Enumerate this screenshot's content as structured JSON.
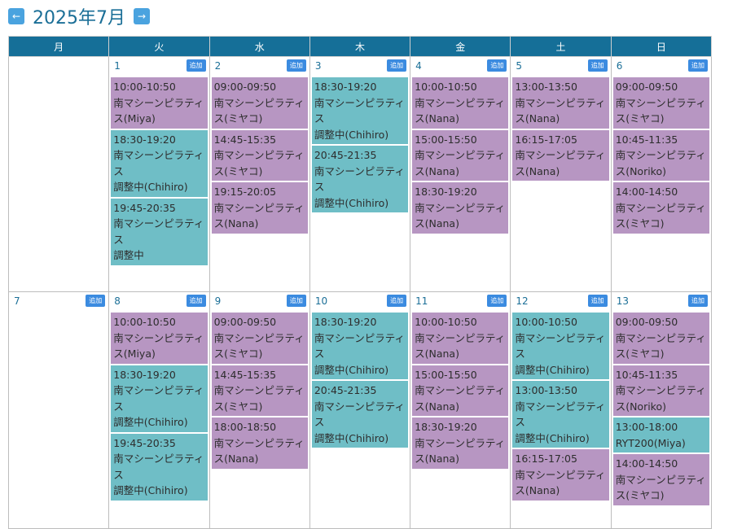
{
  "header": {
    "prev_label": "←",
    "title": "2025年7月",
    "next_label": "→"
  },
  "weekdays": [
    "月",
    "火",
    "水",
    "木",
    "金",
    "土",
    "日"
  ],
  "add_label": "追加",
  "colors": {
    "purple": "#b796c2",
    "teal": "#6fbec6",
    "header": "#156f98",
    "accent": "#1b6f97"
  },
  "weeks": [
    [
      {
        "date": "",
        "events": []
      },
      {
        "date": "1",
        "events": [
          {
            "time": "10:00-10:50",
            "title": "南マシーンピラティス(Miya)",
            "note": "",
            "color": "purple"
          },
          {
            "time": "18:30-19:20",
            "title": "南マシーンピラティス",
            "note": "調整中(Chihiro)",
            "color": "teal"
          },
          {
            "time": "19:45-20:35",
            "title": "南マシーンピラティス",
            "note": "調整中",
            "color": "teal"
          }
        ]
      },
      {
        "date": "2",
        "events": [
          {
            "time": "09:00-09:50",
            "title": "南マシーンピラティス(ミヤコ)",
            "note": "",
            "color": "purple"
          },
          {
            "time": "14:45-15:35",
            "title": "南マシーンピラティス(ミヤコ)",
            "note": "",
            "color": "purple"
          },
          {
            "time": "19:15-20:05",
            "title": "南マシーンピラティス(Nana)",
            "note": "",
            "color": "purple"
          }
        ]
      },
      {
        "date": "3",
        "events": [
          {
            "time": "18:30-19:20",
            "title": "南マシーンピラティス",
            "note": "調整中(Chihiro)",
            "color": "teal"
          },
          {
            "time": "20:45-21:35",
            "title": "南マシーンピラティス",
            "note": "調整中(Chihiro)",
            "color": "teal"
          }
        ]
      },
      {
        "date": "4",
        "events": [
          {
            "time": "10:00-10:50",
            "title": "南マシーンピラティス(Nana)",
            "note": "",
            "color": "purple"
          },
          {
            "time": "15:00-15:50",
            "title": "南マシーンピラティス(Nana)",
            "note": "",
            "color": "purple"
          },
          {
            "time": "18:30-19:20",
            "title": "南マシーンピラティス(Nana)",
            "note": "",
            "color": "purple"
          }
        ]
      },
      {
        "date": "5",
        "events": [
          {
            "time": "13:00-13:50",
            "title": "南マシーンピラティス(Nana)",
            "note": "",
            "color": "purple"
          },
          {
            "time": "16:15-17:05",
            "title": "南マシーンピラティス(Nana)",
            "note": "",
            "color": "purple"
          }
        ]
      },
      {
        "date": "6",
        "events": [
          {
            "time": "09:00-09:50",
            "title": "南マシーンピラティス(ミヤコ)",
            "note": "",
            "color": "purple"
          },
          {
            "time": "10:45-11:35",
            "title": "南マシーンピラティス(Noriko)",
            "note": "",
            "color": "purple"
          },
          {
            "time": "14:00-14:50",
            "title": "南マシーンピラティス(ミヤコ)",
            "note": "",
            "color": "purple"
          }
        ]
      }
    ],
    [
      {
        "date": "7",
        "events": []
      },
      {
        "date": "8",
        "events": [
          {
            "time": "10:00-10:50",
            "title": "南マシーンピラティス(Miya)",
            "note": "",
            "color": "purple"
          },
          {
            "time": "18:30-19:20",
            "title": "南マシーンピラティス",
            "note": "調整中(Chihiro)",
            "color": "teal"
          },
          {
            "time": "19:45-20:35",
            "title": "南マシーンピラティス",
            "note": "調整中(Chihiro)",
            "color": "teal"
          }
        ]
      },
      {
        "date": "9",
        "events": [
          {
            "time": "09:00-09:50",
            "title": "南マシーンピラティス(ミヤコ)",
            "note": "",
            "color": "purple"
          },
          {
            "time": "14:45-15:35",
            "title": "南マシーンピラティス(ミヤコ)",
            "note": "",
            "color": "purple"
          },
          {
            "time": "18:00-18:50",
            "title": "南マシーンピラティス(Nana)",
            "note": "",
            "color": "purple"
          }
        ]
      },
      {
        "date": "10",
        "events": [
          {
            "time": "18:30-19:20",
            "title": "南マシーンピラティス",
            "note": "調整中(Chihiro)",
            "color": "teal"
          },
          {
            "time": "20:45-21:35",
            "title": "南マシーンピラティス",
            "note": "調整中(Chihiro)",
            "color": "teal"
          }
        ]
      },
      {
        "date": "11",
        "events": [
          {
            "time": "10:00-10:50",
            "title": "南マシーンピラティス(Nana)",
            "note": "",
            "color": "purple"
          },
          {
            "time": "15:00-15:50",
            "title": "南マシーンピラティス(Nana)",
            "note": "",
            "color": "purple"
          },
          {
            "time": "18:30-19:20",
            "title": "南マシーンピラティス(Nana)",
            "note": "",
            "color": "purple"
          }
        ]
      },
      {
        "date": "12",
        "events": [
          {
            "time": "10:00-10:50",
            "title": "南マシーンピラティス",
            "note": "調整中(Chihiro)",
            "color": "teal"
          },
          {
            "time": "13:00-13:50",
            "title": "南マシーンピラティス",
            "note": "調整中(Chihiro)",
            "color": "teal"
          },
          {
            "time": "16:15-17:05",
            "title": "南マシーンピラティス(Nana)",
            "note": "",
            "color": "purple"
          }
        ]
      },
      {
        "date": "13",
        "events": [
          {
            "time": "09:00-09:50",
            "title": "南マシーンピラティス(ミヤコ)",
            "note": "",
            "color": "purple"
          },
          {
            "time": "10:45-11:35",
            "title": "南マシーンピラティス(Noriko)",
            "note": "",
            "color": "purple"
          },
          {
            "time": "13:00-18:00",
            "title": "RYT200(Miya)",
            "note": "",
            "color": "teal"
          },
          {
            "time": "14:00-14:50",
            "title": "南マシーンピラティス(ミヤコ)",
            "note": "",
            "color": "purple"
          }
        ]
      }
    ]
  ]
}
